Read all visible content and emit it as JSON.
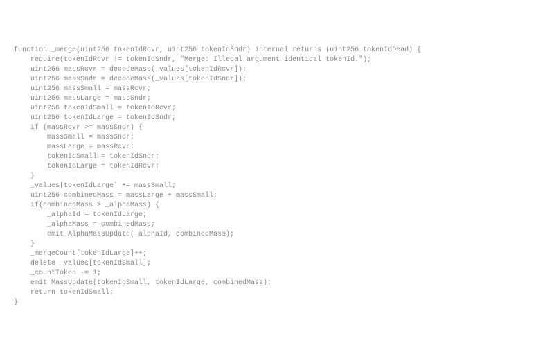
{
  "code": {
    "lines": [
      "function _merge(uint256 tokenIdRcvr, uint256 tokenIdSndr) internal returns (uint256 tokenIdDead) {",
      "    require(tokenIdRcvr != tokenIdSndr, \"Merge: Illegal argument identical tokenId.\");",
      "",
      "    uint256 massRcvr = decodeMass(_values[tokenIdRcvr]);",
      "    uint256 massSndr = decodeMass(_values[tokenIdSndr]);",
      "",
      "    uint256 massSmall = massRcvr;",
      "    uint256 massLarge = massSndr;",
      "",
      "    uint256 tokenIdSmall = tokenIdRcvr;",
      "    uint256 tokenIdLarge = tokenIdSndr;",
      "",
      "    if (massRcvr >= massSndr) {",
      "",
      "        massSmall = massSndr;",
      "        massLarge = massRcvr;",
      "",
      "        tokenIdSmall = tokenIdSndr;",
      "        tokenIdLarge = tokenIdRcvr;",
      "    }",
      "",
      "    _values[tokenIdLarge] += massSmall;",
      "",
      "    uint256 combinedMass = massLarge + massSmall;",
      "",
      "    if(combinedMass > _alphaMass) {",
      "        _alphaId = tokenIdLarge;",
      "        _alphaMass = combinedMass;",
      "        emit AlphaMassUpdate(_alphaId, combinedMass);",
      "    }",
      "",
      "    _mergeCount[tokenIdLarge]++;",
      "",
      "    delete _values[tokenIdSmall];",
      "",
      "    _countToken -= 1;",
      "",
      "    emit MassUpdate(tokenIdSmall, tokenIdLarge, combinedMass);",
      "",
      "    return tokenIdSmall;",
      "}"
    ]
  }
}
